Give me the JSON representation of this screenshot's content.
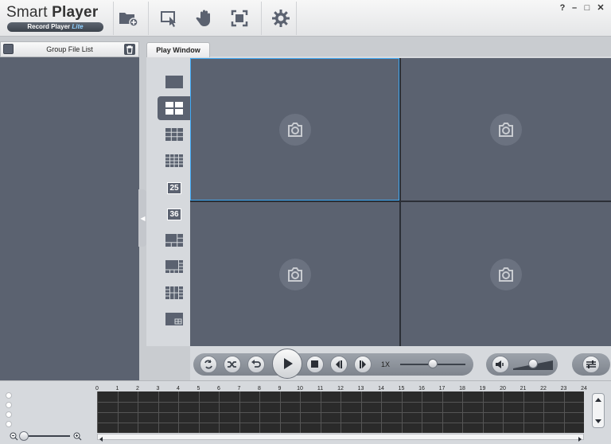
{
  "app": {
    "title_part1": "Smart",
    "title_part2": "Player",
    "subtitle_main": "Record Player",
    "subtitle_lite": "Lite"
  },
  "window_controls": {
    "help": "?",
    "minimize": "–",
    "maximize": "□",
    "close": "✕"
  },
  "left_panel": {
    "header_label": "Group File List"
  },
  "tabs": [
    {
      "label": "Play Window"
    }
  ],
  "layouts": [
    {
      "name": "layout-1"
    },
    {
      "name": "layout-4",
      "active": true
    },
    {
      "name": "layout-9"
    },
    {
      "name": "layout-16"
    },
    {
      "name": "layout-25",
      "label": "25"
    },
    {
      "name": "layout-36",
      "label": "36"
    },
    {
      "name": "layout-6"
    },
    {
      "name": "layout-8"
    },
    {
      "name": "layout-13"
    },
    {
      "name": "layout-pip"
    }
  ],
  "player": {
    "speed_label": "1X",
    "speed_level": 0.5,
    "volume_level": 0.5
  },
  "timeline": {
    "hours": [
      "0",
      "1",
      "2",
      "3",
      "4",
      "5",
      "6",
      "7",
      "8",
      "9",
      "10",
      "11",
      "12",
      "13",
      "14",
      "15",
      "16",
      "17",
      "18",
      "19",
      "20",
      "21",
      "22",
      "23",
      "24"
    ]
  },
  "colors": {
    "pane_bg": "#5b6270",
    "selection": "#3fa9f5",
    "panel_bg": "#5b6270",
    "accent_lite": "#8fd0ff"
  }
}
